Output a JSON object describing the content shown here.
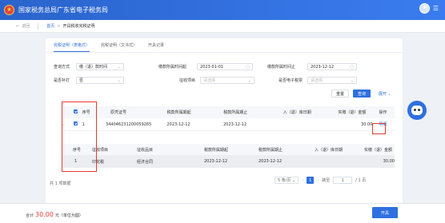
{
  "header": {
    "title": "国家税务总局广东省电子税务局"
  },
  "breadcrumb": {
    "back": "返回",
    "home": "首页",
    "sep": ">",
    "current": "开具税收完税证明"
  },
  "tabs": [
    "完税证明（表格式）",
    "完税证明（文书式）",
    "开具记录"
  ],
  "form": {
    "query_type": {
      "label": "查询方式",
      "value": "缴（退）款时间"
    },
    "tax_start": {
      "label": "缴款所属时间起",
      "value": "2023-01-01"
    },
    "tax_end": {
      "label": "缴款所属时间止",
      "value": "2023-12-12"
    },
    "print_mark": {
      "label": "是否补打",
      "value": "否"
    },
    "tax_type": {
      "label": "征收项目",
      "placeholder": "请选择"
    },
    "e_tax": {
      "label": "是否电子税票",
      "placeholder": "请选择"
    },
    "reset": "重置",
    "query": "查询",
    "expand": "展开"
  },
  "table": {
    "headers": [
      "序号",
      "原凭证号",
      "税款所属期起",
      "税款所属期止",
      "入（退）库日期",
      "实缴（退）金额",
      "操作"
    ],
    "rows": [
      {
        "index": "1",
        "voucher": "344046231200059265",
        "start": "2023-12-12",
        "end": "2023-12-12",
        "date": "",
        "amount": "30.00",
        "action": "明细"
      }
    ]
  },
  "subtable": {
    "headers": [
      "序号",
      "征收项目",
      "征收品目",
      "税款所属期起",
      "税款所属期止",
      "入（退）库日期",
      "实缴（退）金额"
    ],
    "rows": [
      {
        "index": "1",
        "item": "印花税",
        "category": "经济合同",
        "start": "2023-12-12",
        "end": "2023-12-12",
        "date": "",
        "amount": "30.00"
      }
    ]
  },
  "pagination": {
    "total": "共 1 项数据",
    "size": "5 条/页",
    "current": "1",
    "goto_label": "跳至",
    "goto_value": "1",
    "pages": "/ 1 页"
  },
  "footer": {
    "total_label": "合计",
    "total_value": "30.00",
    "unit": "元（单位为圆）",
    "submit": "开具"
  }
}
